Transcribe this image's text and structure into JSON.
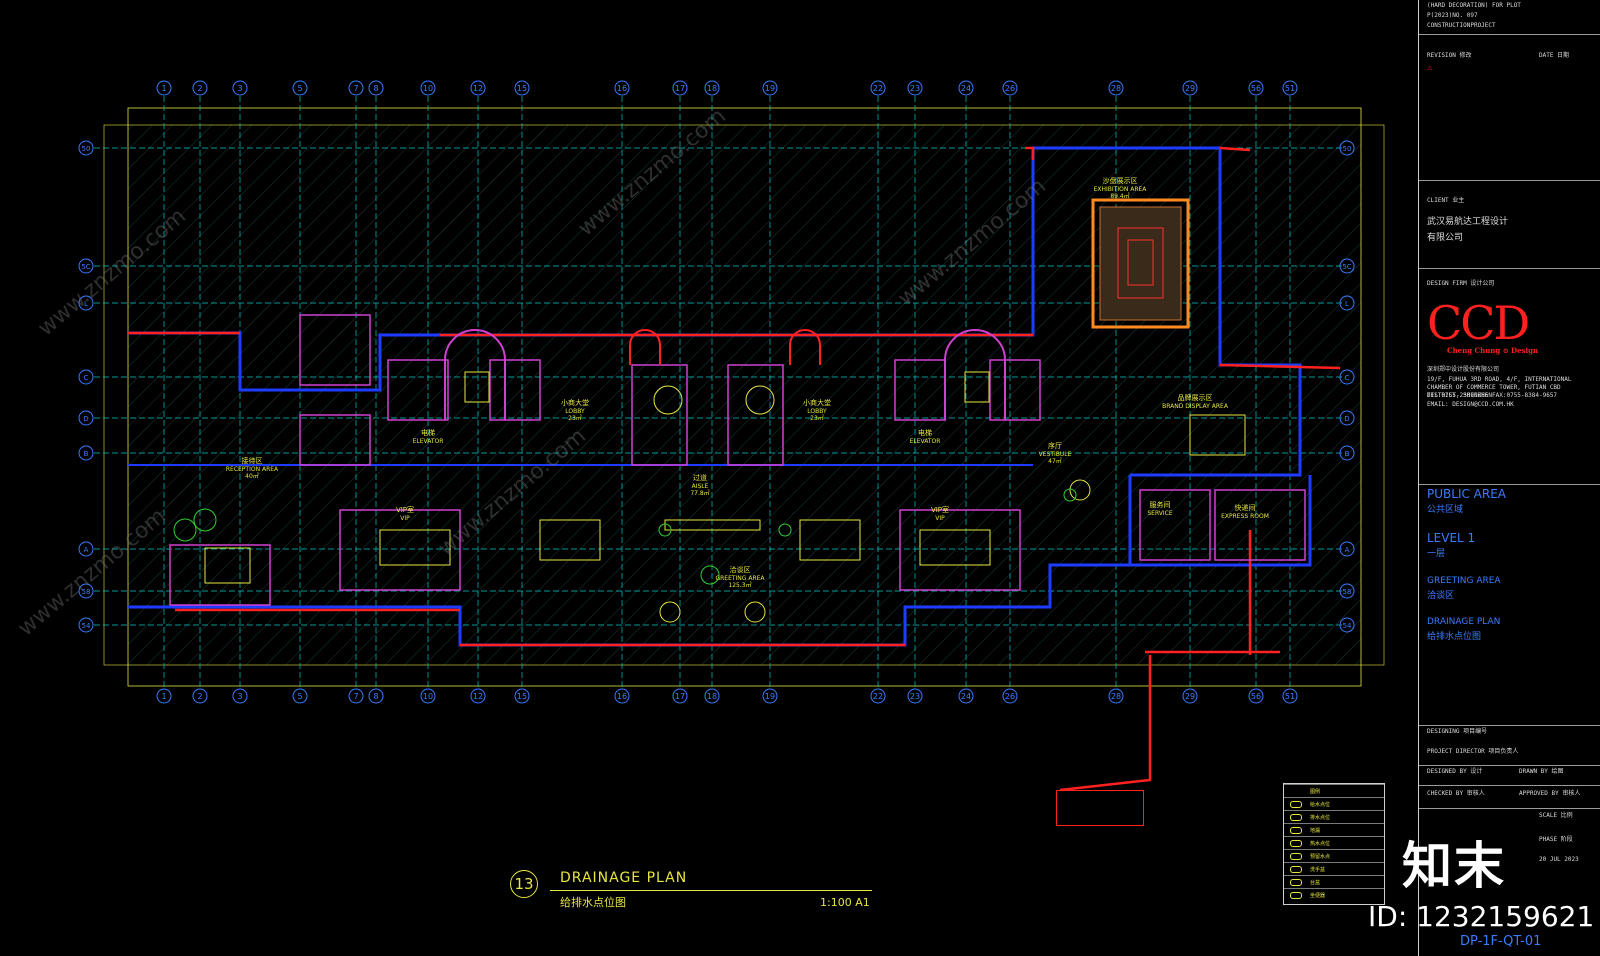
{
  "header_lines": [
    "(HARD DECORATION) FOR PLOT",
    "P(2023)NO. 097",
    "CONSTRUCTIONPROJECT"
  ],
  "revision": {
    "label": "REVISION 修改",
    "date_label": "DATE 日期"
  },
  "client": {
    "label": "CLIENT 业主",
    "name_line1": "武汉易航达工程设计",
    "name_line2": "有限公司"
  },
  "design_firm": {
    "label": "DESIGN FIRM 设计公司",
    "logo": "CCD",
    "logo_sub": "Cheng Chung ⊙ Design",
    "company_cn": "深圳郑中设计股份有限公司",
    "address": "19/F, FUHUA 3RD ROAD, 4/F, INTERNATIONAL CHAMBER OF COMMERCE TOWER, FUTIAN CBD DISTRICT, SHENZHEN",
    "tel": "TEL:0755-23090666     FAX:0755-8384-9657",
    "email": "EMAIL: DESIGN@CCD.COM.HK"
  },
  "drawing_info": {
    "area_en": "PUBLIC AREA",
    "area_cn": "公共区域",
    "level_en": "LEVEL 1",
    "level_cn": "一层",
    "zone_en": "GREETING AREA",
    "zone_cn": "洽谈区",
    "plan_en": "DRAINAGE PLAN",
    "plan_cn": "给排水点位图"
  },
  "signoff": {
    "designing": "DESIGNING 项目编号",
    "project_director": "PROJECT DIRECTOR 项目负责人",
    "designed_by": "DESIGNED BY 设计",
    "drawn_by": "DRAWN BY 绘图",
    "checked_by": "CHECKED BY 审核人",
    "approved_by": "APPROVED BY 审核人",
    "scale": "SCALE 比例",
    "phase": "PHASE 阶段",
    "date": "20 JUL 2023"
  },
  "title_block": {
    "number": "13",
    "title_en": "DRAINAGE PLAN",
    "title_cn": "给排水点位图",
    "scale": "1:100  A1"
  },
  "sheet_number": "DP-1F-QT-01",
  "watermark": {
    "brand": "知末",
    "id": "ID: 1232159621",
    "url": "www.znzmo.com"
  },
  "grid": {
    "columns": [
      "1",
      "2",
      "3",
      "5",
      "7",
      "8",
      "10",
      "12",
      "15",
      "16",
      "17",
      "18",
      "19",
      "22",
      "23",
      "24",
      "26",
      "28",
      "29",
      "56",
      "51"
    ],
    "rows": [
      "50",
      "5C",
      "L",
      "C",
      "D",
      "B",
      "A",
      "58",
      "54"
    ]
  },
  "rooms": [
    {
      "en": "RECEPTION AREA",
      "cn": "接待区",
      "area": "40㎡"
    },
    {
      "en": "LOBBY",
      "cn": "小商大堂",
      "area": "23㎡"
    },
    {
      "en": "LOBBY",
      "cn": "小商大堂",
      "area": "23㎡"
    },
    {
      "en": "AISLE",
      "cn": "过道",
      "area": "77.8㎡"
    },
    {
      "en": "GREETING AREA",
      "cn": "洽谈区",
      "area": "125.3㎡"
    },
    {
      "en": "VESTIBULE",
      "cn": "序厅",
      "area": "47㎡"
    },
    {
      "en": "EXHIBITION AREA",
      "cn": "沙盘展示区",
      "area": "89.4㎡"
    },
    {
      "en": "VIP",
      "cn": "VIP室",
      "area": ""
    },
    {
      "en": "VIP",
      "cn": "VIP室",
      "area": ""
    },
    {
      "en": "SERVICE",
      "cn": "服务间",
      "area": ""
    },
    {
      "en": "EXPRESS ROOM",
      "cn": "快递间",
      "area": ""
    },
    {
      "en": "BRAND DISPLAY AREA",
      "cn": "品牌展示区",
      "area": ""
    },
    {
      "en": "ELEVATOR",
      "cn": "电梯",
      "area": ""
    },
    {
      "en": "ELEVATOR",
      "cn": "电梯",
      "area": ""
    }
  ],
  "legend": {
    "items": [
      "图例",
      "给水点位",
      "排水点位",
      "地漏",
      "热水点位",
      "预留水点",
      "洗手盆",
      "台盆",
      "坐便器"
    ]
  },
  "colors": {
    "bg": "#000000",
    "grid": "#00c8c8",
    "wall": "#1e3cff",
    "red": "#ff2020",
    "yellow": "#e6e640",
    "magenta": "#d040d0",
    "green": "#30d030"
  }
}
